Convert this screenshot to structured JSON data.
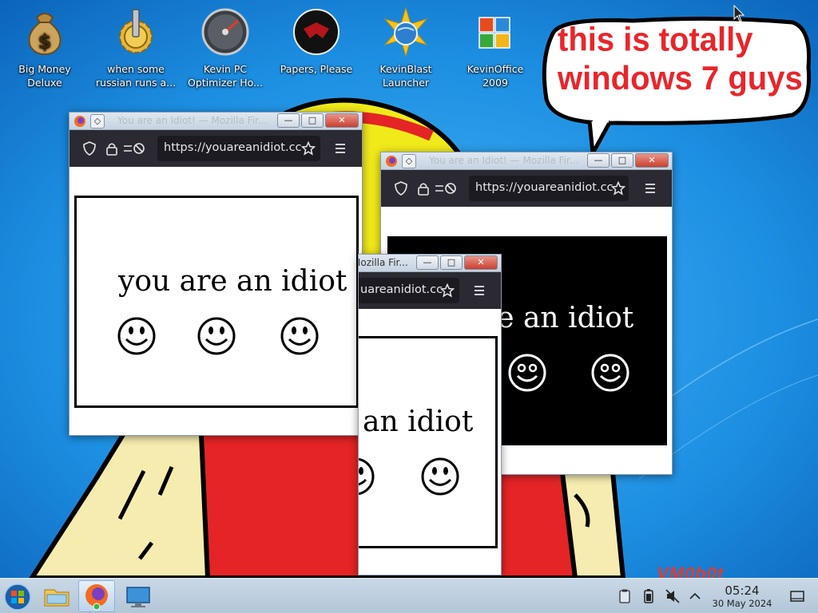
{
  "desktop": {
    "icons": [
      {
        "label": "Big Money\nDeluxe",
        "icon": "money-bag-icon"
      },
      {
        "label": "when some\nrussian runs a...",
        "icon": "gear-icon"
      },
      {
        "label": "Kevin PC\nOptimizer Ho...",
        "icon": "speedometer-icon"
      },
      {
        "label": "Papers, Please",
        "icon": "papers-please-icon"
      },
      {
        "label": "KevinBlast\nLauncher",
        "icon": "starburst-globe-icon"
      },
      {
        "label": "KevinOffice\n2009",
        "icon": "office-logo-icon"
      }
    ],
    "speech_bubble": "this is totally windows 7 guys",
    "watermark": "VM0b0t"
  },
  "windows": [
    {
      "id": "win1",
      "title": "You are an Idiot! — Mozilla Fir...",
      "url": "https://youareanidiot.cc",
      "content_text": "you are an idiot",
      "theme": "light",
      "smileys": 3
    },
    {
      "id": "win2",
      "title": "You are an Idiot! — Mozilla Fir...",
      "url": "https://youareanidiot.cc",
      "content_text": "re an idiot",
      "theme": "dark",
      "smileys": 2
    },
    {
      "id": "win3",
      "title": "Mozilla Fir...",
      "url": "uareanidiot.cc",
      "content_text": "an idiot",
      "theme": "light",
      "smileys": 2
    }
  ],
  "window_buttons": {
    "minimize": "—",
    "maximize": "□",
    "close": "✕",
    "pin": "◇"
  },
  "taskbar": {
    "apps": [
      {
        "name": "start-button",
        "icon": "windows-orb-icon"
      },
      {
        "name": "file-manager",
        "icon": "folder-icon"
      },
      {
        "name": "firefox",
        "icon": "firefox-icon",
        "active": true
      },
      {
        "name": "system-settings",
        "icon": "monitor-icon"
      }
    ],
    "tray": [
      "clipboard-icon",
      "battery-icon",
      "speaker-muted-icon",
      "chevron-up-icon"
    ],
    "clock": {
      "time": "05:24",
      "date": "30 May 2024"
    }
  },
  "colors": {
    "accent_red": "#e8262b",
    "firefox_nav": "#2b2a33",
    "taskbar": "#c4d4e3"
  }
}
